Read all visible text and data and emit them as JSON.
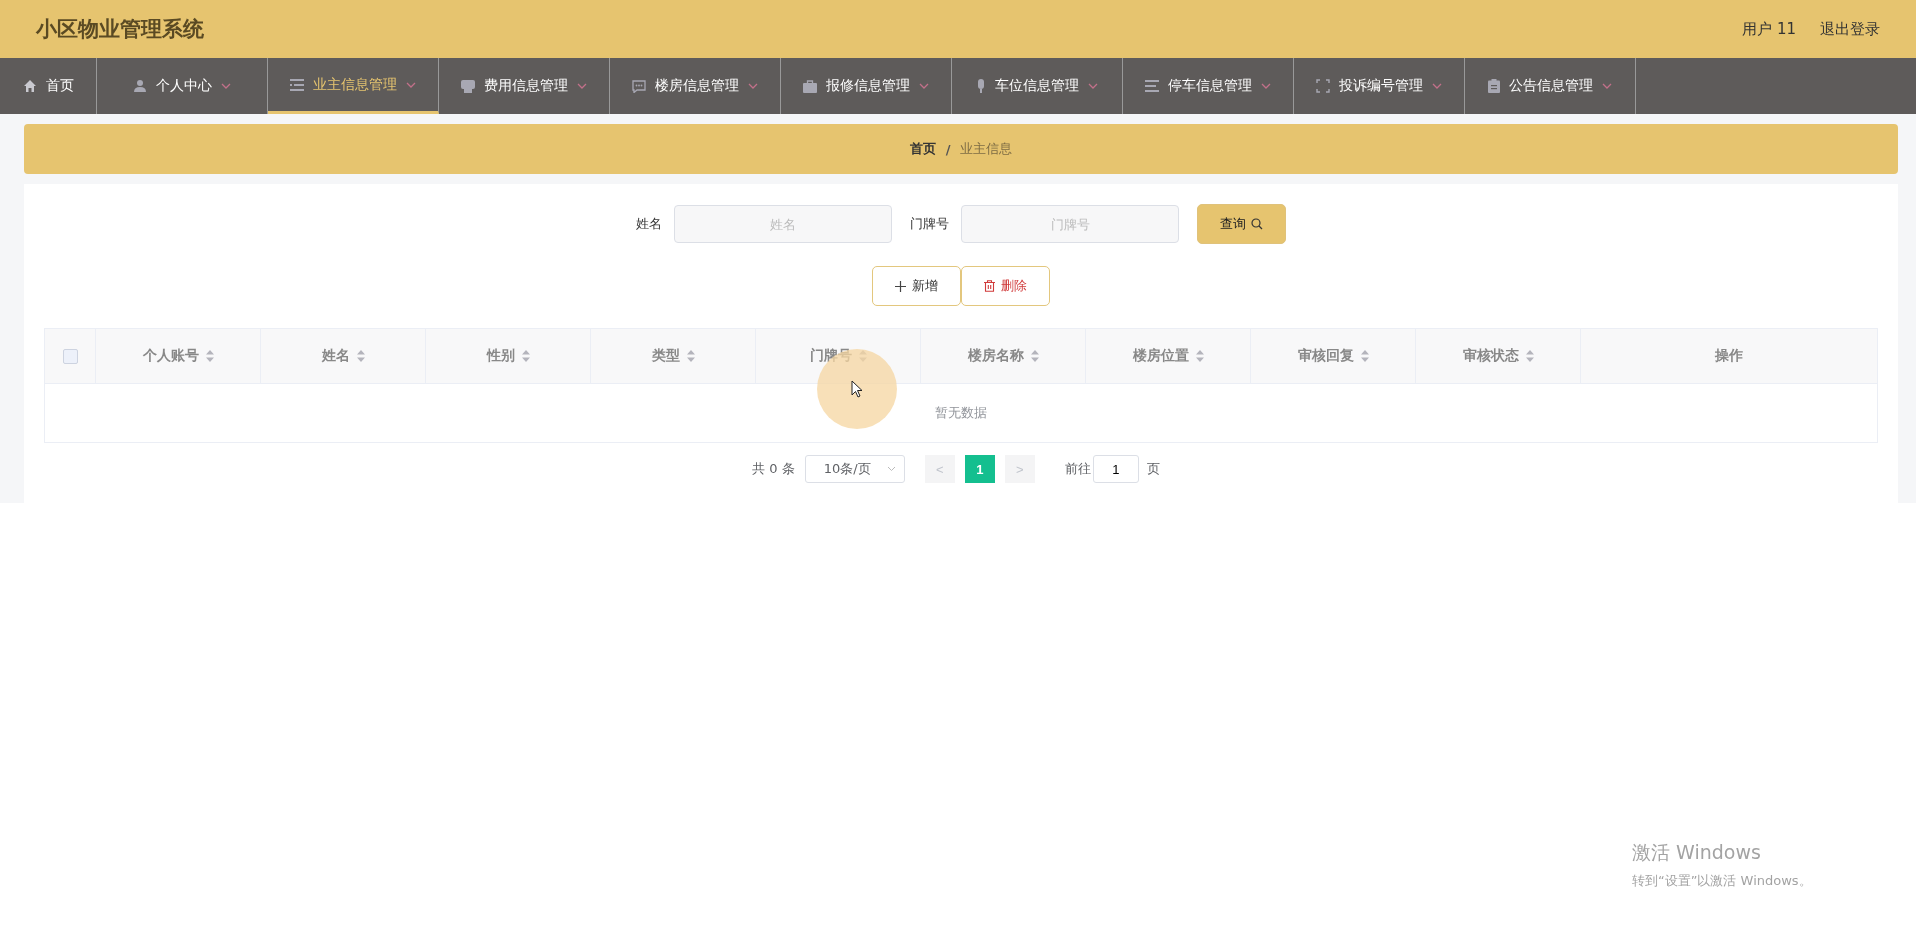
{
  "header": {
    "title": "小区物业管理系统",
    "user": "用户 11",
    "logout": "退出登录"
  },
  "nav": [
    {
      "label": "首页",
      "selected": false,
      "caret": false
    },
    {
      "label": "个人中心",
      "selected": false,
      "caret": true
    },
    {
      "label": "业主信息管理",
      "selected": true,
      "caret": true
    },
    {
      "label": "费用信息管理",
      "selected": false,
      "caret": true
    },
    {
      "label": "楼房信息管理",
      "selected": false,
      "caret": true
    },
    {
      "label": "报修信息管理",
      "selected": false,
      "caret": true
    },
    {
      "label": "车位信息管理",
      "selected": false,
      "caret": true
    },
    {
      "label": "停车信息管理",
      "selected": false,
      "caret": true
    },
    {
      "label": "投诉编号管理",
      "selected": false,
      "caret": true
    },
    {
      "label": "公告信息管理",
      "selected": false,
      "caret": true
    }
  ],
  "breadcrumb": {
    "home": "首页",
    "separator": "/",
    "current": "业主信息"
  },
  "search": {
    "fields": [
      {
        "label": "姓名",
        "placeholder": "姓名"
      },
      {
        "label": "门牌号",
        "placeholder": "门牌号"
      }
    ],
    "button": "查询"
  },
  "actions": {
    "add": "新增",
    "delete": "删除"
  },
  "table": {
    "select_all": {
      "checked": false
    },
    "columns": [
      {
        "label": "个人账号",
        "sortable": true
      },
      {
        "label": "姓名",
        "sortable": true
      },
      {
        "label": "性别",
        "sortable": true
      },
      {
        "label": "类型",
        "sortable": true
      },
      {
        "label": "门牌号",
        "sortable": true
      },
      {
        "label": "楼房名称",
        "sortable": true
      },
      {
        "label": "楼房位置",
        "sortable": true
      },
      {
        "label": "审核回复",
        "sortable": true
      },
      {
        "label": "审核状态",
        "sortable": true
      },
      {
        "label": "操作",
        "sortable": false
      }
    ],
    "empty_text": "暂无数据"
  },
  "pagination": {
    "total": "共 0 条",
    "page_size": "10条/页",
    "prev": "<",
    "pages": [
      {
        "label": "1",
        "selected": true
      }
    ],
    "next": ">",
    "goto_label": "前往",
    "goto_value": "1",
    "goto_suffix": "页"
  },
  "watermark": {
    "title": "激活 Windows",
    "subtitle": "转到“设置”以激活 Windows。"
  }
}
